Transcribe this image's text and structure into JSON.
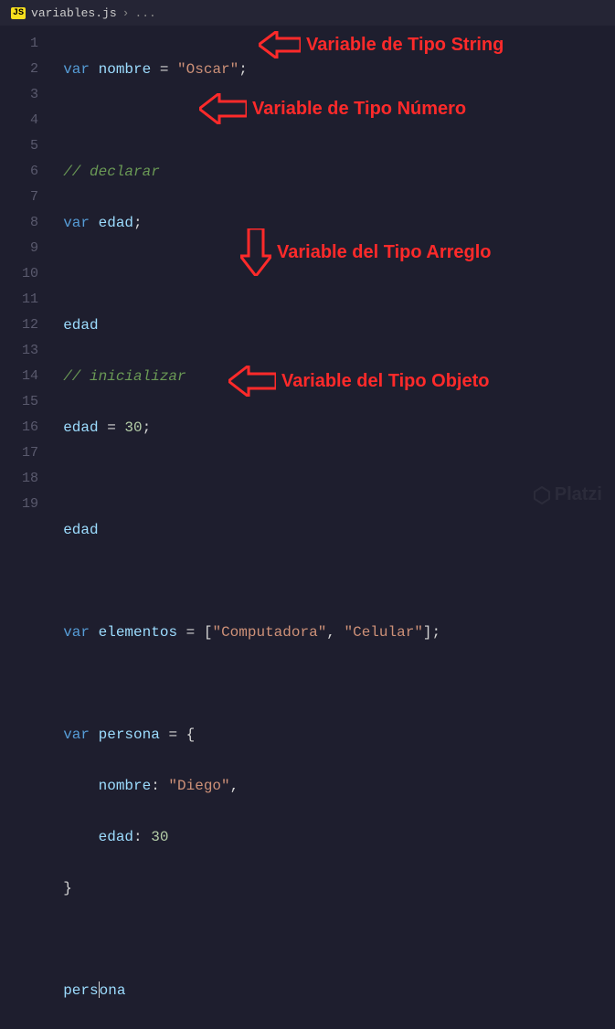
{
  "tab": {
    "file_badge": "JS",
    "filename": "variables.js",
    "crumb": "›",
    "crumb_rest": "..."
  },
  "gutter": [
    "1",
    "2",
    "3",
    "4",
    "5",
    "6",
    "7",
    "8",
    "9",
    "10",
    "11",
    "12",
    "13",
    "14",
    "15",
    "16",
    "17",
    "18",
    "19"
  ],
  "code": {
    "l1": {
      "kw": "var",
      "id": "nombre",
      "eq": " = ",
      "str": "\"Oscar\"",
      "semi": ";"
    },
    "l3_cmt": "// declarar",
    "l4": {
      "kw": "var",
      "id": "edad",
      "semi": ";"
    },
    "l6": "edad",
    "l7_cmt": "// inicializar",
    "l8": {
      "id": "edad",
      "eq": " = ",
      "num": "30",
      "semi": ";"
    },
    "l10": "edad",
    "l12": {
      "kw": "var",
      "id": "elementos",
      "eq": " = ",
      "lb": "[",
      "s1": "\"Computadora\"",
      "comma": ", ",
      "s2": "\"Celular\"",
      "rb": "]",
      "semi": ";"
    },
    "l14": {
      "kw": "var",
      "id": "persona",
      "eq": " = ",
      "brace": "{"
    },
    "l15": {
      "prop": "nombre",
      "colon": ": ",
      "str": "\"Diego\"",
      "comma": ","
    },
    "l16": {
      "prop": "edad",
      "colon": ": ",
      "num": "30"
    },
    "l17_brace": "}",
    "l19": "persona"
  },
  "annotations": {
    "a_string": "Variable de Tipo String",
    "a_number": "Variable de Tipo Número",
    "a_array": "Variable del Tipo Arreglo",
    "a_object": "Variable del Tipo Objeto"
  },
  "watermark": "Platzi"
}
